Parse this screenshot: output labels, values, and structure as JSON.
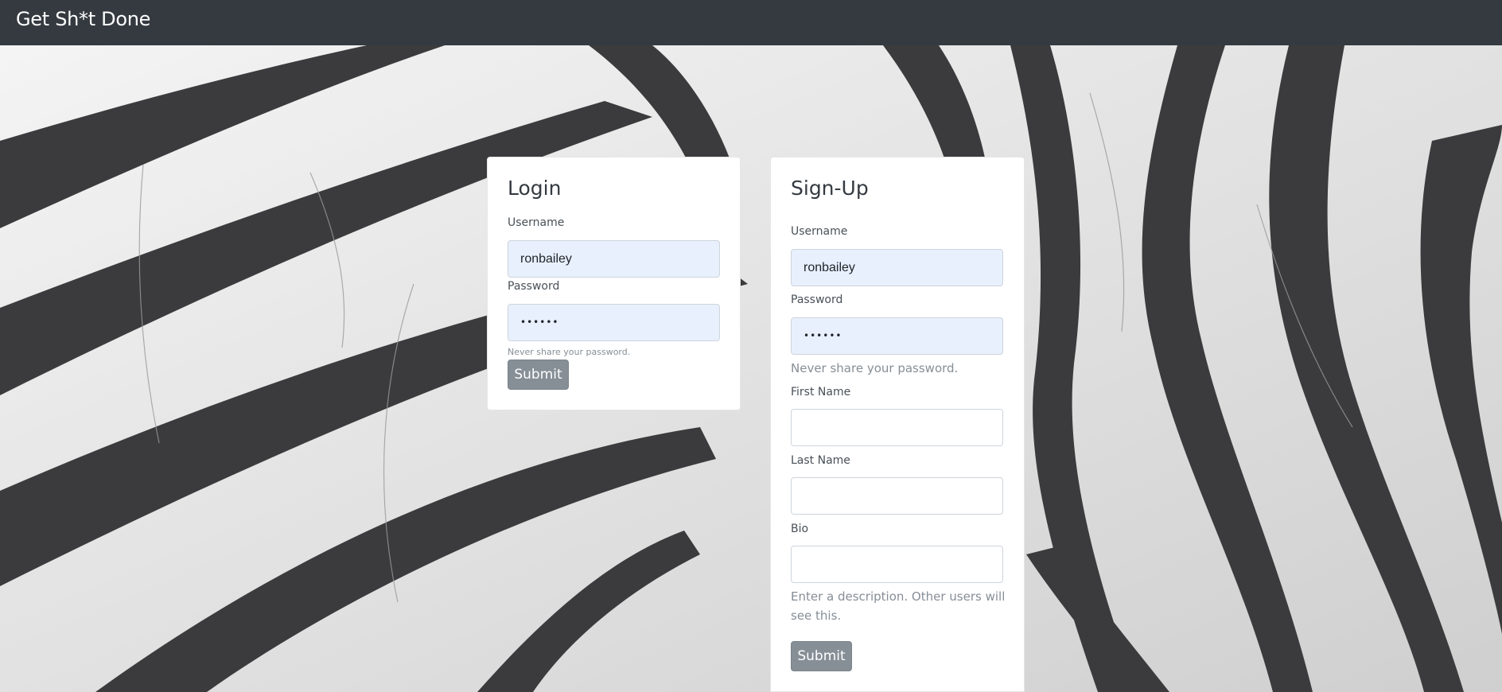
{
  "navbar": {
    "brand": "Get Sh*t Done"
  },
  "login": {
    "title": "Login",
    "username_label": "Username",
    "username_value": "ronbailey",
    "password_label": "Password",
    "password_value": "••••••",
    "password_help": "Never share your password.",
    "submit_label": "Submit"
  },
  "signup": {
    "title": "Sign-Up",
    "username_label": "Username",
    "username_value": "ronbailey",
    "password_label": "Password",
    "password_value": "••••••",
    "password_help": "Never share your password.",
    "first_name_label": "First Name",
    "first_name_value": "",
    "last_name_label": "Last Name",
    "last_name_value": "",
    "bio_label": "Bio",
    "bio_value": "",
    "bio_help": "Enter a description. Other users will see this.",
    "submit_label": "Submit"
  },
  "colors": {
    "navbar": "#343a40",
    "autofill": "#e8f0fe",
    "button": "#868e96"
  }
}
